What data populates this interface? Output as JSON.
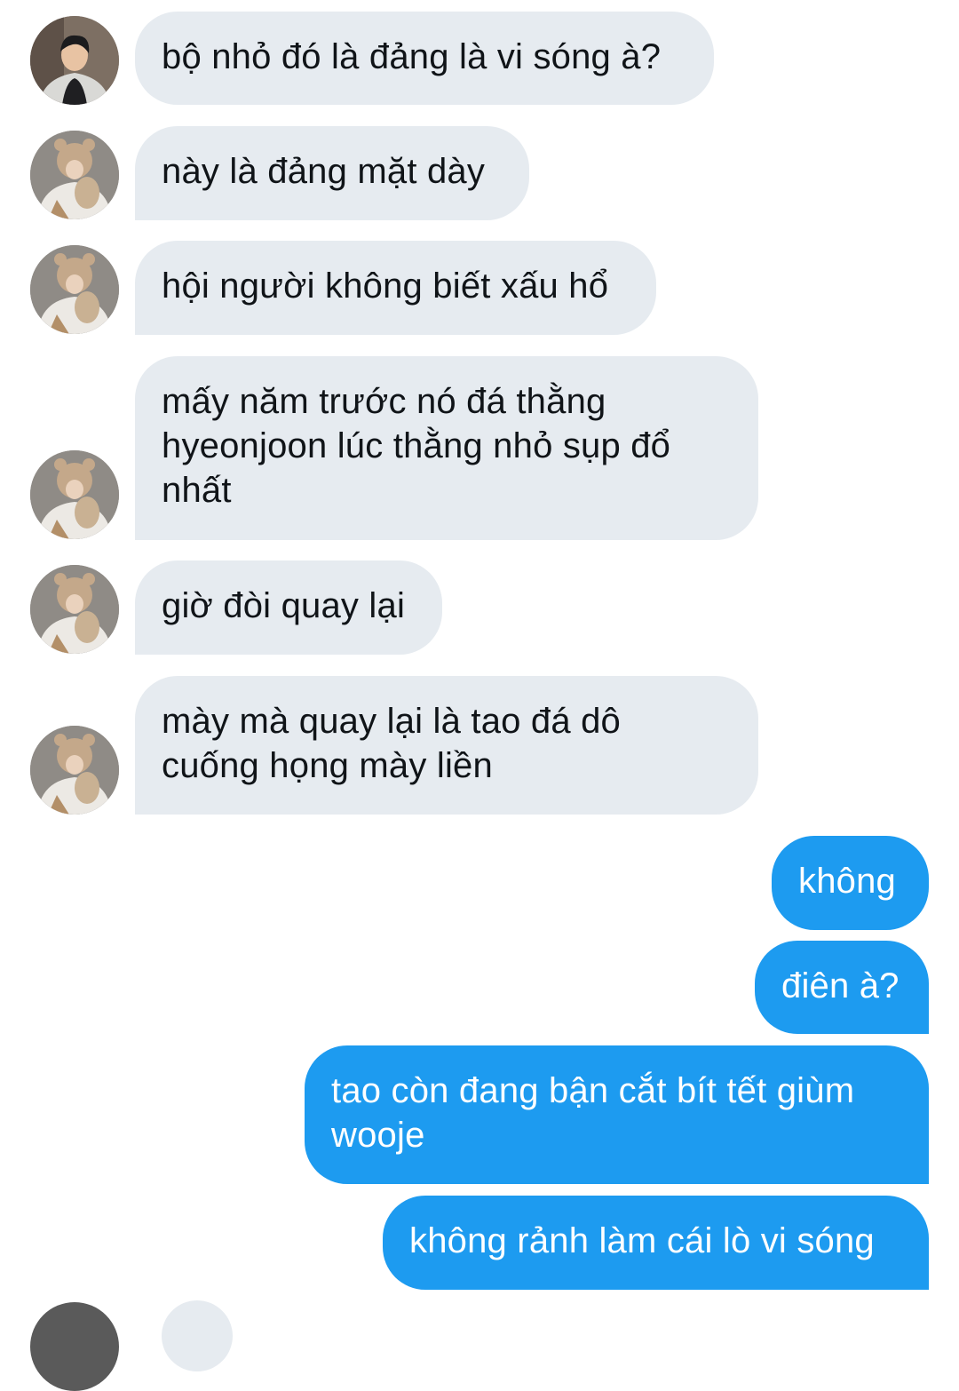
{
  "messages": [
    {
      "direction": "incoming",
      "sender": "user-1",
      "lines": [
        "bộ nhỏ đó là đảng là vi sóng à?"
      ]
    },
    {
      "direction": "incoming",
      "sender": "user-2",
      "lines": [
        "này là đảng mặt dày"
      ]
    },
    {
      "direction": "incoming",
      "sender": "user-2",
      "lines": [
        "hội người không biết xấu hổ"
      ]
    },
    {
      "direction": "incoming",
      "sender": "user-2",
      "lines": [
        "mấy năm trước nó đá thằng",
        "hyeonjoon lúc thằng nhỏ sụp đổ",
        "nhất"
      ]
    },
    {
      "direction": "incoming",
      "sender": "user-2",
      "lines": [
        "giờ đòi quay lại"
      ]
    },
    {
      "direction": "incoming",
      "sender": "user-2",
      "lines": [
        "mày mà quay lại là tao đá dô",
        "cuống họng mày liền"
      ]
    },
    {
      "direction": "outgoing",
      "lines": [
        "không"
      ]
    },
    {
      "direction": "outgoing",
      "lines": [
        "điên à?"
      ]
    },
    {
      "direction": "outgoing",
      "lines": [
        "tao còn đang bận cắt bít tết giùm",
        "wooje"
      ]
    },
    {
      "direction": "outgoing",
      "lines": [
        "không rảnh làm cái lò vi sóng"
      ]
    }
  ],
  "colors": {
    "incoming_bubble": "#e6ebf0",
    "incoming_text": "#101418",
    "outgoing_bubble": "#1d9bf0",
    "outgoing_text": "#ffffff"
  }
}
